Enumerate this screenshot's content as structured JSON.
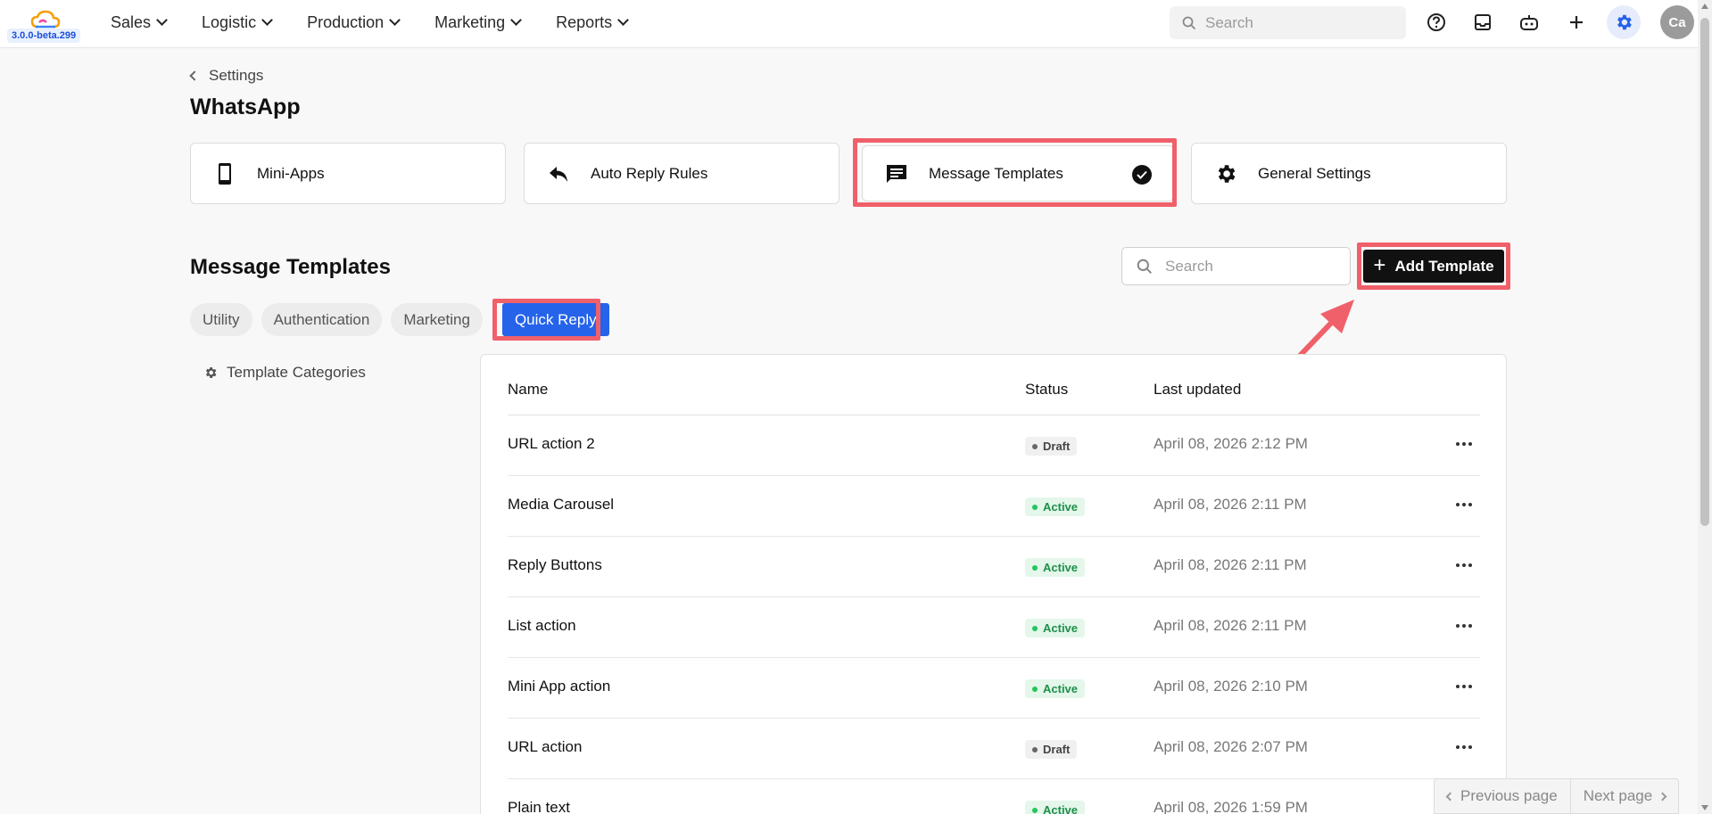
{
  "app": {
    "version": "3.0.0-beta.299",
    "avatar_initials": "Ca"
  },
  "nav": [
    {
      "label": "Sales"
    },
    {
      "label": "Logistic"
    },
    {
      "label": "Production"
    },
    {
      "label": "Marketing"
    },
    {
      "label": "Reports"
    }
  ],
  "topbar": {
    "search_placeholder": "Search"
  },
  "breadcrumb": {
    "label": "Settings"
  },
  "page": {
    "title": "WhatsApp"
  },
  "cards": [
    {
      "label": "Mini-Apps",
      "icon": "phone-icon"
    },
    {
      "label": "Auto Reply Rules",
      "icon": "reply-icon"
    },
    {
      "label": "Message Templates",
      "icon": "message-icon",
      "selected": true
    },
    {
      "label": "General Settings",
      "icon": "gear-icon"
    }
  ],
  "templates": {
    "title": "Message Templates",
    "search_placeholder": "Search",
    "add_label": "Add Template",
    "categories_label": "Template Categories",
    "filters": [
      {
        "label": "Utility"
      },
      {
        "label": "Authentication"
      },
      {
        "label": "Marketing"
      },
      {
        "label": "Quick Reply",
        "active": true
      }
    ],
    "columns": {
      "name": "Name",
      "status": "Status",
      "updated": "Last updated"
    },
    "rows": [
      {
        "name": "URL action 2",
        "status": "Draft",
        "updated": "April 08, 2026 2:12 PM"
      },
      {
        "name": "Media Carousel",
        "status": "Active",
        "updated": "April 08, 2026 2:11 PM"
      },
      {
        "name": "Reply Buttons",
        "status": "Active",
        "updated": "April 08, 2026 2:11 PM"
      },
      {
        "name": "List action",
        "status": "Active",
        "updated": "April 08, 2026 2:11 PM"
      },
      {
        "name": "Mini App action",
        "status": "Active",
        "updated": "April 08, 2026 2:10 PM"
      },
      {
        "name": "URL action",
        "status": "Draft",
        "updated": "April 08, 2026 2:07 PM"
      },
      {
        "name": "Plain text",
        "status": "Active",
        "updated": "April 08, 2026 1:59 PM"
      }
    ]
  },
  "pager": {
    "prev_label": "Previous page",
    "next_label": "Next page"
  },
  "colors": {
    "accent": "#2563eb",
    "highlight": "#f0606a",
    "active_status": "#1f8f4b"
  }
}
